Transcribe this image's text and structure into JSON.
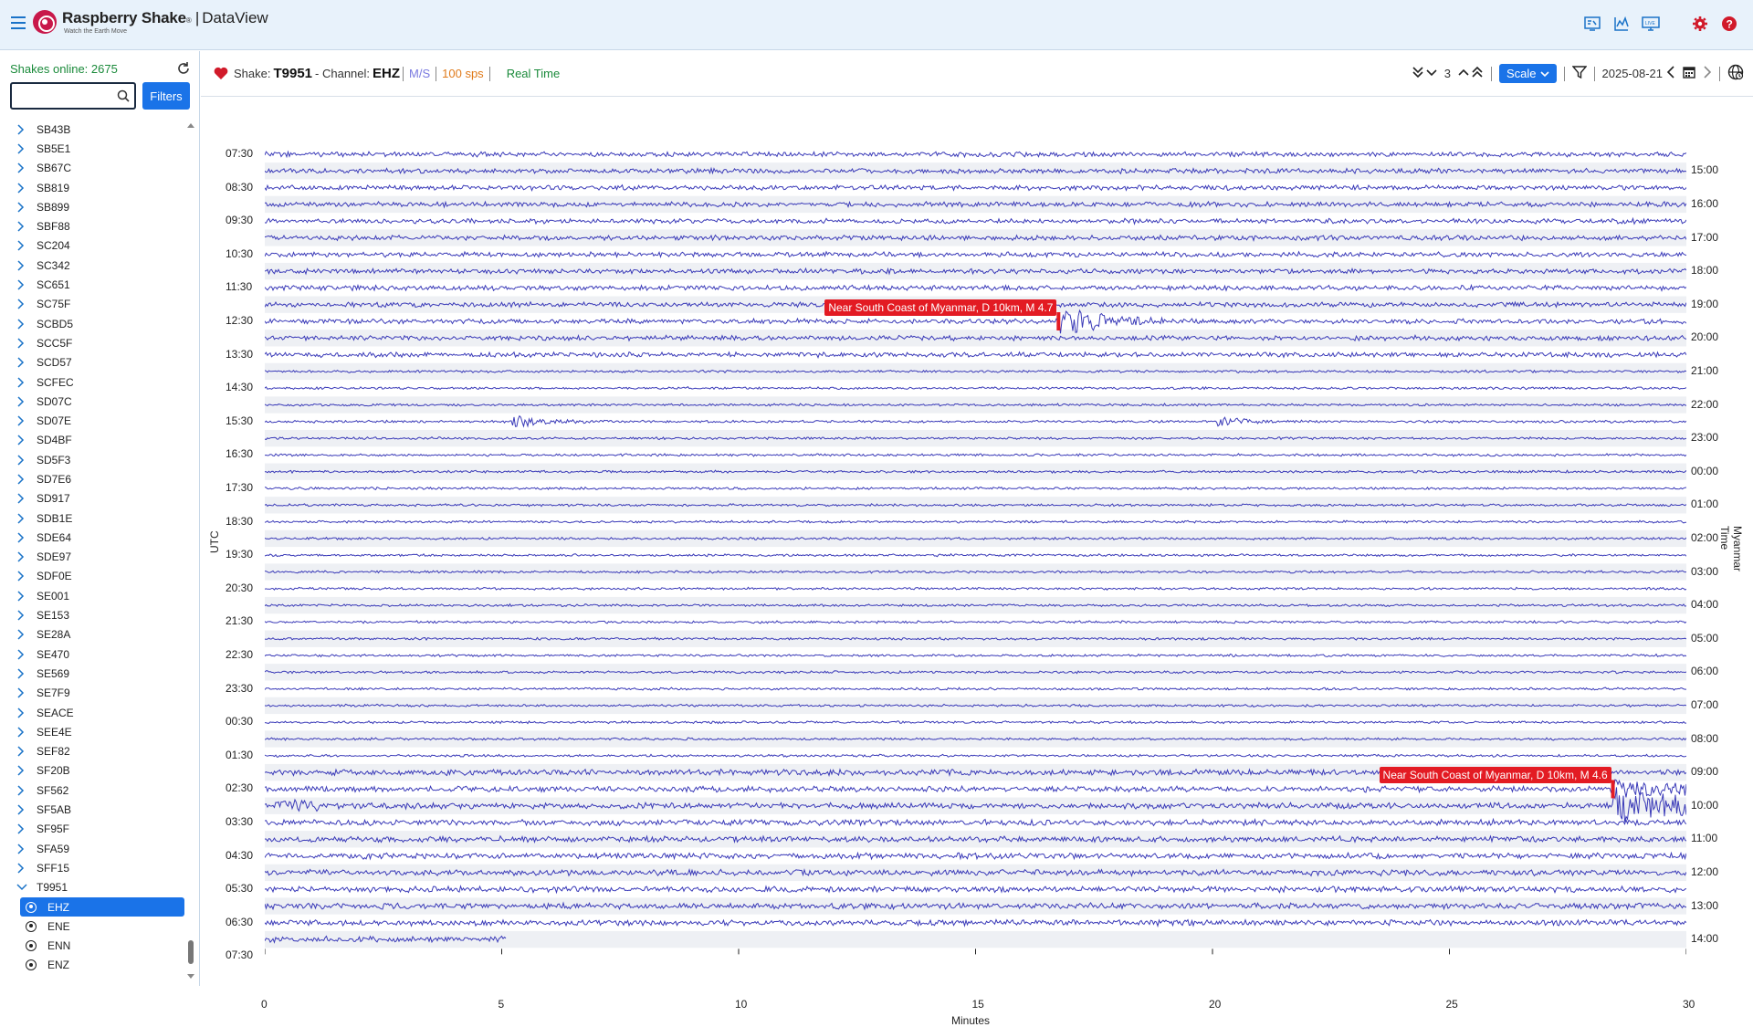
{
  "header": {
    "brand_name": "Raspberry Shake",
    "brand_reg": "®",
    "brand_sep": "|",
    "app_name": "DataView",
    "tagline": "Watch the Earth Move"
  },
  "sidebar": {
    "online_text": "Shakes online: 2675",
    "search_placeholder": "",
    "filters_label": "Filters",
    "stations": [
      "SB43B",
      "SB5E1",
      "SB67C",
      "SB819",
      "SB899",
      "SBF88",
      "SC204",
      "SC342",
      "SC651",
      "SC75F",
      "SCBD5",
      "SCC5F",
      "SCD57",
      "SCFEC",
      "SD07C",
      "SD07E",
      "SD4BF",
      "SD5F3",
      "SD7E6",
      "SD917",
      "SDB1E",
      "SDE64",
      "SDE97",
      "SDF0E",
      "SE001",
      "SE153",
      "SE28A",
      "SE470",
      "SE569",
      "SE7F9",
      "SEACE",
      "SEE4E",
      "SEF82",
      "SF20B",
      "SF562",
      "SF5AB",
      "SF95F",
      "SFA59",
      "SFF15"
    ],
    "expanded_station": "T9951",
    "channels": [
      {
        "label": "EHZ",
        "active": true
      },
      {
        "label": "ENE",
        "active": false
      },
      {
        "label": "ENN",
        "active": false
      },
      {
        "label": "ENZ",
        "active": false
      }
    ]
  },
  "toolbar": {
    "shake_prefix": "Shake:",
    "shake_id": "T9951",
    "channel_prefix": "- Channel:",
    "channel": "EHZ",
    "units": "M/S",
    "sps": "100 sps",
    "mode": "Real Time",
    "scale_value": "3",
    "scale_label": "Scale",
    "date": "2025-08-21"
  },
  "helicorder": {
    "left_axis_label": "UTC",
    "right_axis_label": "Myanmar Time",
    "x_axis_label": "Minutes",
    "x_ticks": [
      "0",
      "5",
      "10",
      "15",
      "20",
      "25",
      "30"
    ],
    "left_ticks": [
      "07:30",
      "08:30",
      "09:30",
      "10:30",
      "11:30",
      "12:30",
      "13:30",
      "14:30",
      "15:30",
      "16:30",
      "17:30",
      "18:30",
      "19:30",
      "20:30",
      "21:30",
      "22:30",
      "23:30",
      "00:30",
      "01:30",
      "02:30",
      "03:30",
      "04:30",
      "05:30",
      "06:30",
      "07:30"
    ],
    "right_ticks": [
      "15:00",
      "16:00",
      "17:00",
      "18:00",
      "19:00",
      "20:00",
      "21:00",
      "22:00",
      "23:00",
      "00:00",
      "01:00",
      "02:00",
      "03:00",
      "04:00",
      "05:00",
      "06:00",
      "07:00",
      "08:00",
      "09:00",
      "10:00",
      "11:00",
      "12:00",
      "13:00",
      "14:00"
    ],
    "trace_color": "#3a3ab8",
    "events": [
      {
        "label": "Near South Coast of Myanmar, D 10km, M 4.7"
      },
      {
        "label": "Near South Coast of Myanmar, D 10km, M 4.6"
      }
    ]
  }
}
